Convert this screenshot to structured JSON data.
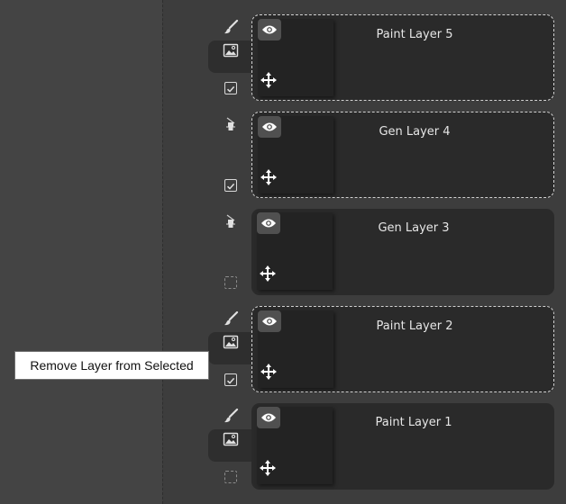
{
  "layers": [
    {
      "name": "Paint Layer 5",
      "kind": "paint",
      "selected": true,
      "checked": true,
      "image_button": true
    },
    {
      "name": "Gen Layer 4",
      "kind": "gen",
      "selected": true,
      "checked": true,
      "image_button": false
    },
    {
      "name": "Gen Layer 3",
      "kind": "gen",
      "selected": false,
      "checked": false,
      "image_button": false
    },
    {
      "name": "Paint Layer 2",
      "kind": "paint",
      "selected": true,
      "checked": true,
      "image_button": true
    },
    {
      "name": "Paint Layer 1",
      "kind": "paint",
      "selected": false,
      "checked": false,
      "image_button": true
    }
  ],
  "tooltip": {
    "text": "Remove Layer from Selected"
  },
  "icons": {
    "paint": "brush-icon",
    "gen": "generate-icon",
    "image": "image-icon",
    "visibility": "eye-icon",
    "move": "move-icon"
  },
  "colors": {
    "background": "#3d3d3d",
    "left_panel": "#444444",
    "card": "#2a2a2a",
    "thumbnail": "#232323",
    "text": "#e6e6e6"
  }
}
